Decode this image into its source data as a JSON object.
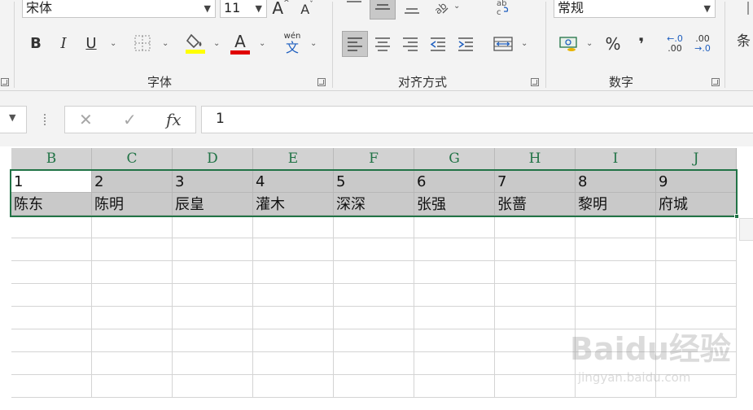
{
  "ribbon": {
    "font_group": {
      "label": "字体",
      "font_name": "宋体",
      "font_size": "11",
      "grow_label": "A",
      "shrink_label": "A",
      "bold": "B",
      "italic": "I",
      "underline": "U",
      "font_color_label": "A",
      "pinyin_top": "wén",
      "pinyin_bottom": "文",
      "fill_color": "#ffff00",
      "font_color": "#e00000"
    },
    "align_group": {
      "label": "对齐方式"
    },
    "number_group": {
      "label": "数字",
      "format": "常规",
      "percent": "%",
      "comma": "❜",
      "inc_decimal_top": "←.0",
      "inc_decimal_bottom": ".00",
      "dec_decimal_top": ".00",
      "dec_decimal_bottom": "→.0"
    },
    "cut_label": "条"
  },
  "formula_bar": {
    "cancel": "✕",
    "enter": "✓",
    "fx": "fx",
    "value": "1"
  },
  "sheet": {
    "columns": [
      "B",
      "C",
      "D",
      "E",
      "F",
      "G",
      "H",
      "I",
      "J"
    ],
    "rows": [
      [
        "1",
        "2",
        "3",
        "4",
        "5",
        "6",
        "7",
        "8",
        "9"
      ],
      [
        "陈东",
        "陈明",
        "辰皇",
        "灌木",
        "深深",
        "张强",
        "张蔷",
        "黎明",
        "府城"
      ]
    ],
    "accent": "#217346"
  },
  "watermark": {
    "text": "Baidu经验",
    "sub": "jingyan.baidu.com"
  }
}
